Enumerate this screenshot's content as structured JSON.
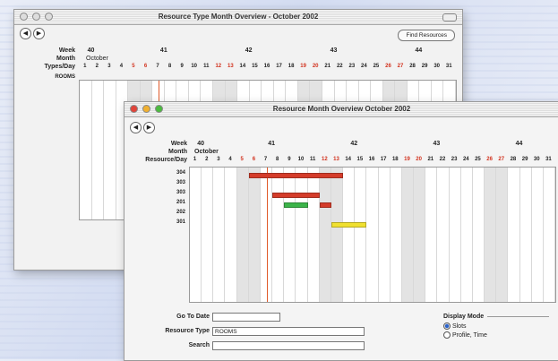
{
  "back_window": {
    "title": "Resource Type Month Overview - October 2002",
    "find_button": "Find Resources",
    "labels": {
      "week": "Week",
      "month": "Month",
      "types": "Types/Day",
      "rooms": "ROOMS"
    },
    "weeks": [
      "40",
      "41",
      "42",
      "43",
      "44"
    ],
    "month": "October",
    "days": [
      "1",
      "2",
      "3",
      "4",
      "5",
      "6",
      "7",
      "8",
      "9",
      "10",
      "11",
      "12",
      "13",
      "14",
      "15",
      "16",
      "17",
      "18",
      "19",
      "20",
      "21",
      "22",
      "23",
      "24",
      "25",
      "26",
      "27",
      "28",
      "29",
      "30",
      "31"
    ],
    "red_days": [
      "5",
      "6",
      "12",
      "13",
      "19",
      "20",
      "26",
      "27"
    ]
  },
  "front_window": {
    "title": "Resource Month Overview   October 2002",
    "labels": {
      "week": "Week",
      "month": "Month",
      "resource": "Resource/Day"
    },
    "weeks": [
      "40",
      "41",
      "42",
      "43",
      "44"
    ],
    "month": "October",
    "days": [
      "1",
      "2",
      "3",
      "4",
      "5",
      "6",
      "7",
      "8",
      "9",
      "10",
      "11",
      "12",
      "13",
      "14",
      "15",
      "16",
      "17",
      "18",
      "19",
      "20",
      "21",
      "22",
      "23",
      "24",
      "25",
      "26",
      "27",
      "28",
      "29",
      "30",
      "31"
    ],
    "red_days": [
      "5",
      "6",
      "12",
      "13",
      "19",
      "20",
      "26",
      "27"
    ],
    "resources": [
      "304",
      "303",
      "303",
      "201",
      "202",
      "301"
    ],
    "bookings": [
      {
        "row": 0,
        "start": 6,
        "end": 13,
        "color": "#d43c2a"
      },
      {
        "row": 2,
        "start": 8,
        "end": 11,
        "color": "#d43c2a"
      },
      {
        "row": 3,
        "start": 9,
        "end": 10,
        "color": "#3cb44a"
      },
      {
        "row": 3,
        "start": 12,
        "end": 12,
        "color": "#d43c2a"
      },
      {
        "row": 5,
        "start": 13,
        "end": 15,
        "color": "#f0e030"
      }
    ],
    "today": 7,
    "footer": {
      "goto_label": "Go To Date",
      "goto_value": "",
      "type_label": "Resource Type",
      "type_value": "ROOMS",
      "search_label": "Search",
      "search_value": "",
      "display_mode_label": "Display Mode",
      "modes": [
        {
          "label": "Slots",
          "selected": true
        },
        {
          "label": "Profile, Time",
          "selected": false
        }
      ]
    }
  }
}
